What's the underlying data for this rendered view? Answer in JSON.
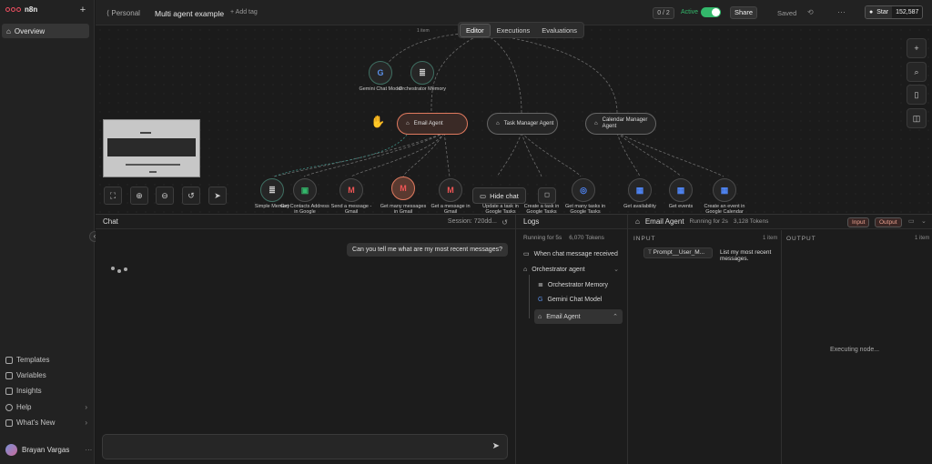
{
  "app": {
    "logo": "n8n"
  },
  "sidebar": {
    "overview": "Overview",
    "bottom": [
      {
        "label": "Templates",
        "icon": "template-icon"
      },
      {
        "label": "Variables",
        "icon": "variables-icon"
      },
      {
        "label": "Insights",
        "icon": "insights-icon"
      },
      {
        "label": "Help",
        "icon": "help-icon"
      },
      {
        "label": "What's New",
        "icon": "bell-icon"
      }
    ],
    "user": "Brayan Vargas"
  },
  "topbar": {
    "project": "Personal",
    "workflow": "Multi agent example",
    "add_tag": "+ Add tag",
    "counter": "0 / 2",
    "active_label": "Active",
    "share": "Share",
    "saved": "Saved",
    "star": "Star",
    "stars": "152,587"
  },
  "tabs": [
    "Editor",
    "Executions",
    "Evaluations"
  ],
  "canvas": {
    "top_nodes": [
      {
        "label": "Gemini Chat Model",
        "icon": "gemini-icon"
      },
      {
        "label": "Orchestrator Memory",
        "icon": "database-icon"
      }
    ],
    "agents": [
      "Email Agent",
      "Task Manager Agent",
      "Calendar Manager Agent"
    ],
    "tool_nodes": [
      "Simple Memory",
      "Get Contacts Address in Google",
      "Send a message - Gmail",
      "Get many messages in Gmail",
      "Get a message in Gmail",
      "Update a task in Google Tasks",
      "Create a task in Google Tasks",
      "Get many tasks in Google Tasks",
      "Get availability",
      "Get events",
      "Create an event in Google Calendar"
    ],
    "edge_label": "1 item",
    "hide_chat": "Hide chat"
  },
  "chat": {
    "title": "Chat",
    "session": "Session: 720dd...",
    "user_message": "Can you tell me what are my most recent messages?",
    "input_placeholder": ""
  },
  "logs": {
    "title": "Logs",
    "running": "Running for 5s",
    "tokens": "6,070 Tokens",
    "tree": [
      {
        "label": "When chat message received",
        "icon": "chat-trigger-icon"
      },
      {
        "label": "Orchestrator agent",
        "icon": "robot-icon"
      },
      {
        "label": "Orchestrator Memory",
        "icon": "database-icon"
      },
      {
        "label": "Gemini Chat Model",
        "icon": "gemini-icon"
      },
      {
        "label": "Email Agent",
        "icon": "robot-icon"
      }
    ]
  },
  "detail": {
    "title": "Email Agent",
    "running": "Running for 2s",
    "tokens": "3,128 Tokens",
    "input_btn": "Input",
    "output_btn": "Output",
    "input_heading": "INPUT",
    "output_heading": "OUTPUT",
    "input_count": "1 item",
    "output_count": "1 item",
    "param": "Prompt__User_M...",
    "param_value": "List my most recent messages.",
    "executing": "Executing node..."
  },
  "colors": {
    "accent": "#ee4f61",
    "active": "#33b86b",
    "input_btn": "#3a2624"
  }
}
